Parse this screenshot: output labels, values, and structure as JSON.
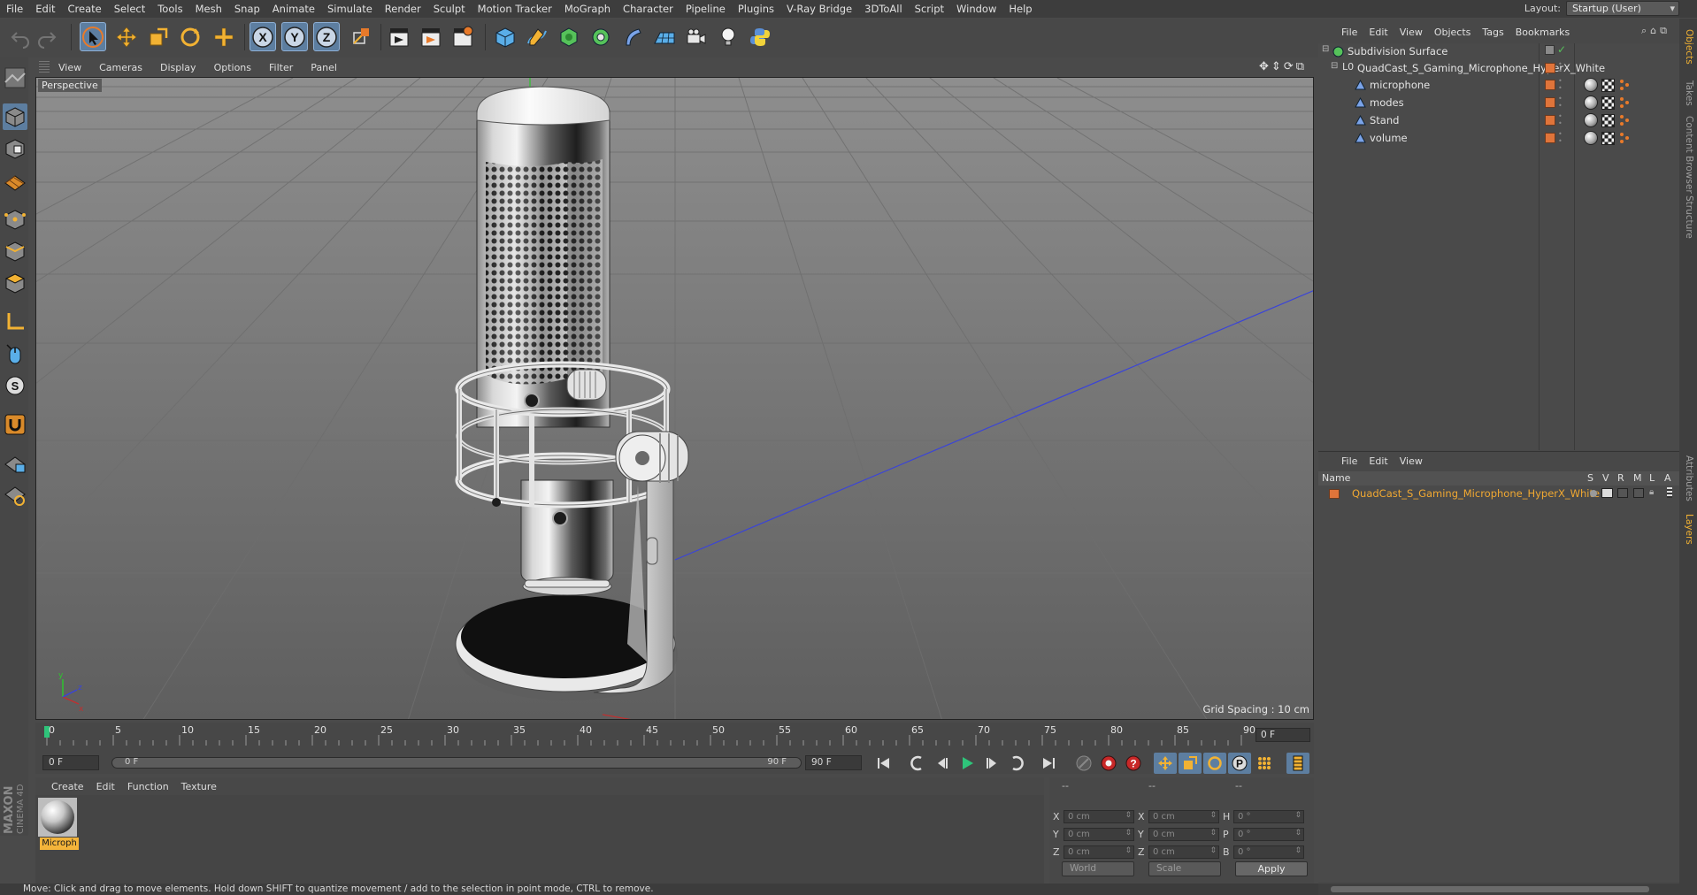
{
  "menubar": {
    "items": [
      "File",
      "Edit",
      "Create",
      "Select",
      "Tools",
      "Mesh",
      "Snap",
      "Animate",
      "Simulate",
      "Render",
      "Sculpt",
      "Motion Tracker",
      "MoGraph",
      "Character",
      "Pipeline",
      "Plugins",
      "V-Ray Bridge",
      "3DToAll",
      "Script",
      "Window",
      "Help"
    ],
    "layout_label": "Layout:",
    "layout_value": "Startup (User)"
  },
  "viewport": {
    "menu": [
      "View",
      "Cameras",
      "Display",
      "Options",
      "Filter",
      "Panel"
    ],
    "label": "Perspective",
    "grid_spacing": "Grid Spacing : 10 cm"
  },
  "timeline": {
    "ticks": [
      "0",
      "5",
      "10",
      "15",
      "20",
      "25",
      "30",
      "35",
      "40",
      "45",
      "50",
      "55",
      "60",
      "65",
      "70",
      "75",
      "80",
      "85",
      "90"
    ],
    "current_frame": "0 F"
  },
  "transport": {
    "start": "0 F",
    "range_start": "0 F",
    "range_end": "90 F",
    "end": "90 F"
  },
  "material_manager": {
    "menu": [
      "Create",
      "Edit",
      "Function",
      "Texture"
    ],
    "material_name": "Microph"
  },
  "coordinates": {
    "header": [
      "--",
      "--",
      "--"
    ],
    "pos": [
      {
        "label": "X",
        "value": "0 cm"
      },
      {
        "label": "Y",
        "value": "0 cm"
      },
      {
        "label": "Z",
        "value": "0 cm"
      }
    ],
    "size": [
      {
        "label": "X",
        "value": "0 cm"
      },
      {
        "label": "Y",
        "value": "0 cm"
      },
      {
        "label": "Z",
        "value": "0 cm"
      }
    ],
    "rot": [
      {
        "label": "H",
        "value": "0 °"
      },
      {
        "label": "P",
        "value": "0 °"
      },
      {
        "label": "B",
        "value": "0 °"
      }
    ],
    "mode_world": "World",
    "mode_scale": "Scale",
    "apply": "Apply"
  },
  "status": "Move: Click and drag to move elements. Hold down SHIFT to quantize movement / add to the selection in point mode, CTRL to remove.",
  "object_manager": {
    "menu": [
      "File",
      "Edit",
      "View",
      "Objects",
      "Tags",
      "Bookmarks"
    ],
    "objects": [
      {
        "name": "Subdivision Surface",
        "level": 0
      },
      {
        "name": "QuadCast_S_Gaming_Microphone_HyperX_White",
        "level": 1
      },
      {
        "name": "microphone",
        "level": 2
      },
      {
        "name": "modes",
        "level": 2
      },
      {
        "name": "Stand",
        "level": 2
      },
      {
        "name": "volume",
        "level": 2
      }
    ]
  },
  "layer_manager": {
    "menu": [
      "File",
      "Edit",
      "View"
    ],
    "columns": [
      "Name",
      "S",
      "V",
      "R",
      "M",
      "L",
      "A"
    ],
    "layers": [
      {
        "name": "QuadCast_S_Gaming_Microphone_HyperX_White"
      }
    ]
  },
  "right_tabs": [
    "Objects",
    "Takes",
    "Content Browser",
    "Structure",
    "Attributes",
    "Layers"
  ],
  "colors": {
    "accent_orange": "#e0743a",
    "layer_name": "#f0a832",
    "axis_blue": "#3a44d8",
    "axis_green": "#2ec42e"
  }
}
